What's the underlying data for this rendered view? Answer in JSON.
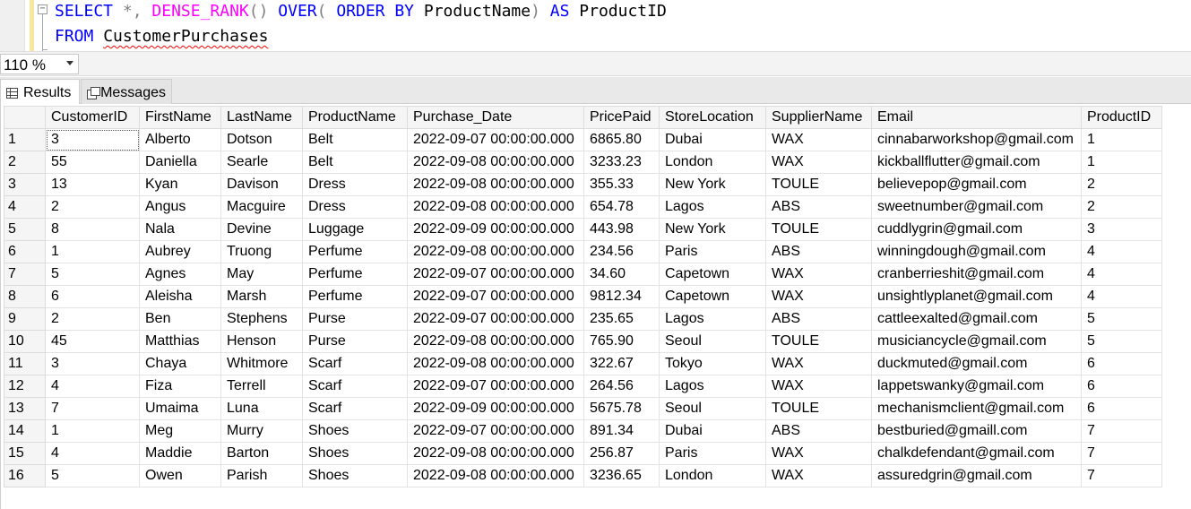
{
  "editor": {
    "line1": {
      "kw_select": "SELECT",
      "star_comma": " *, ",
      "fn_dense_rank": "DENSE_RANK",
      "parens": "()",
      "kw_over": " OVER",
      "paren_open": "( ",
      "kw_order_by": "ORDER BY",
      "col_product": " ProductName",
      "paren_close": ")",
      "kw_as": " AS",
      "alias": " ProductID"
    },
    "line2": {
      "kw_from": "FROM",
      "table": "CustomerPurchases"
    },
    "collapse_glyph": "−"
  },
  "zoom": {
    "value": "110 %"
  },
  "tabs": {
    "results": "Results",
    "messages": "Messages"
  },
  "grid": {
    "columns": [
      "CustomerID",
      "FirstName",
      "LastName",
      "ProductName",
      "Purchase_Date",
      "PricePaid",
      "StoreLocation",
      "SupplierName",
      "Email",
      "ProductID"
    ],
    "rows": [
      [
        "1",
        "3",
        "Alberto",
        "Dotson",
        "Belt",
        "2022-09-07 00:00:00.000",
        "6865.80",
        "Dubai",
        "WAX",
        "cinnabarworkshop@gmail.com",
        "1"
      ],
      [
        "2",
        "55",
        "Daniella",
        "Searle",
        "Belt",
        "2022-09-08 00:00:00.000",
        "3233.23",
        "London",
        "WAX",
        "kickballflutter@gmail.com",
        "1"
      ],
      [
        "3",
        "13",
        "Kyan",
        "Davison",
        "Dress",
        "2022-09-08 00:00:00.000",
        "355.33",
        "New York",
        "TOULE",
        "believepop@gmail.com",
        "2"
      ],
      [
        "4",
        "2",
        "Angus",
        "Macguire",
        "Dress",
        "2022-09-08 00:00:00.000",
        "654.78",
        "Lagos",
        "ABS",
        "sweetnumber@gmail.com",
        "2"
      ],
      [
        "5",
        "8",
        "Nala",
        "Devine",
        "Luggage",
        "2022-09-09 00:00:00.000",
        "443.98",
        "New York",
        "TOULE",
        "cuddlygrin@gmail.com",
        "3"
      ],
      [
        "6",
        "1",
        "Aubrey",
        "Truong",
        "Perfume",
        "2022-09-08 00:00:00.000",
        "234.56",
        "Paris",
        "ABS",
        "winningdough@gmail.com",
        "4"
      ],
      [
        "7",
        "5",
        "Agnes",
        "May",
        "Perfume",
        "2022-09-07 00:00:00.000",
        "34.60",
        "Capetown",
        "WAX",
        "cranberrieshit@gmail.com",
        "4"
      ],
      [
        "8",
        "6",
        "Aleisha",
        "Marsh",
        "Perfume",
        "2022-09-07 00:00:00.000",
        "9812.34",
        "Capetown",
        "WAX",
        "unsightlyplanet@gmail.com",
        "4"
      ],
      [
        "9",
        "2",
        "Ben",
        "Stephens",
        "Purse",
        "2022-09-07 00:00:00.000",
        "235.65",
        "Lagos",
        "ABS",
        "cattleexalted@gmail.com",
        "5"
      ],
      [
        "10",
        "45",
        "Matthias",
        "Henson",
        "Purse",
        "2022-09-08 00:00:00.000",
        "765.90",
        "Seoul",
        "TOULE",
        "musiciancycle@gmail.com",
        "5"
      ],
      [
        "11",
        "3",
        "Chaya",
        "Whitmore",
        "Scarf",
        "2022-09-08 00:00:00.000",
        "322.67",
        "Tokyo",
        "WAX",
        "duckmuted@gmail.com",
        "6"
      ],
      [
        "12",
        "4",
        "Fiza",
        "Terrell",
        "Scarf",
        "2022-09-07 00:00:00.000",
        "264.56",
        "Lagos",
        "WAX",
        "lappetswanky@gmail.com",
        "6"
      ],
      [
        "13",
        "7",
        "Umaima",
        "Luna",
        "Scarf",
        "2022-09-09 00:00:00.000",
        "5675.78",
        "Seoul",
        "TOULE",
        "mechanismclient@gmail.com",
        "6"
      ],
      [
        "14",
        "1",
        "Meg",
        "Murry",
        "Shoes",
        "2022-09-07 00:00:00.000",
        "891.34",
        "Dubai",
        "ABS",
        "bestburied@gmaill.com",
        "7"
      ],
      [
        "15",
        "4",
        "Maddie",
        "Barton",
        "Shoes",
        "2022-09-08 00:00:00.000",
        "256.87",
        "Paris",
        "WAX",
        "chalkdefendant@gmail.com",
        "7"
      ],
      [
        "16",
        "5",
        "Owen",
        "Parish",
        "Shoes",
        "2022-09-08 00:00:00.000",
        "3236.65",
        "London",
        "WAX",
        "assuredgrin@gmail.com",
        "7"
      ]
    ]
  }
}
